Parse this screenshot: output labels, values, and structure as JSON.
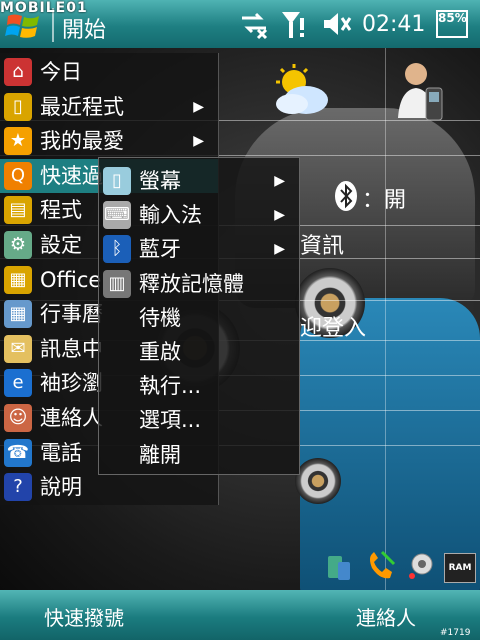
{
  "watermark": "MOBILE01",
  "topbar": {
    "title": "開始",
    "clock": "02:41",
    "battery": "85%",
    "icons": [
      "windows-logo-icon",
      "sync-icon",
      "signal-icon",
      "volume-icon"
    ]
  },
  "desktop": {
    "weather_icon": "weather-icon",
    "contact_icon": "contact-icon",
    "bluetooth_status": "：開",
    "info_label": "資訊",
    "welcome_label": "迎登入"
  },
  "start_menu": {
    "items": [
      {
        "label": "今日",
        "icon": "home-icon",
        "arrow": false
      },
      {
        "label": "最近程式",
        "icon": "folder-icon",
        "arrow": true
      },
      {
        "label": "我的最愛",
        "icon": "star-icon",
        "arrow": true
      },
      {
        "label": "快速過",
        "icon": "quick-icon",
        "arrow": false,
        "highlight": true
      },
      {
        "label": "程式",
        "icon": "programs-icon",
        "arrow": false
      },
      {
        "label": "設定",
        "icon": "settings-icon",
        "arrow": false
      },
      {
        "label": "Office",
        "icon": "office-icon",
        "arrow": false
      },
      {
        "label": "行事曆",
        "icon": "calendar-icon",
        "arrow": false
      },
      {
        "label": "訊息中",
        "icon": "message-icon",
        "arrow": false
      },
      {
        "label": "袖珍瀏",
        "icon": "ie-icon",
        "arrow": false
      },
      {
        "label": "連絡人",
        "icon": "contacts-icon",
        "arrow": false
      },
      {
        "label": "電話",
        "icon": "phone-icon",
        "arrow": false
      },
      {
        "label": "說明",
        "icon": "help-icon",
        "arrow": false
      }
    ]
  },
  "submenu": {
    "items": [
      {
        "label": "螢幕",
        "icon": "screen-icon",
        "arrow": true
      },
      {
        "label": "輸入法",
        "icon": "keyboard-icon",
        "arrow": true
      },
      {
        "label": "藍牙",
        "icon": "bluetooth-icon",
        "arrow": true
      },
      {
        "label": "釋放記憶體",
        "icon": "memory-icon",
        "arrow": false
      },
      {
        "label": "待機",
        "icon": "",
        "arrow": false
      },
      {
        "label": "重啟",
        "icon": "",
        "arrow": false
      },
      {
        "label": "執行...",
        "icon": "",
        "arrow": false
      },
      {
        "label": "選項...",
        "icon": "",
        "arrow": false
      },
      {
        "label": "離開",
        "icon": "",
        "arrow": false
      }
    ]
  },
  "bottombar": {
    "left_soft": "快速撥號",
    "right_soft": "連絡人"
  },
  "tray": {
    "ram_label": "RAM",
    "footer": "#1719"
  }
}
